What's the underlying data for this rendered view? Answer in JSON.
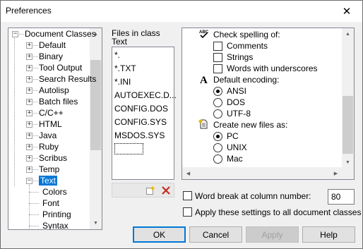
{
  "window": {
    "title": "Preferences",
    "close_glyph": "✕"
  },
  "tree": {
    "items": [
      {
        "label": "Document Classes",
        "expander": "−"
      },
      {
        "label": "Default",
        "expander": "+"
      },
      {
        "label": "Binary",
        "expander": "+"
      },
      {
        "label": "Tool Output",
        "expander": "+"
      },
      {
        "label": "Search Results",
        "expander": "+"
      },
      {
        "label": "Autolisp",
        "expander": "+"
      },
      {
        "label": "Batch files",
        "expander": "+"
      },
      {
        "label": "C/C++",
        "expander": "+"
      },
      {
        "label": "HTML",
        "expander": "+"
      },
      {
        "label": "Java",
        "expander": "+"
      },
      {
        "label": "Ruby",
        "expander": "+"
      },
      {
        "label": "Scribus",
        "expander": "+"
      },
      {
        "label": "Temp",
        "expander": "+"
      },
      {
        "label": "Text",
        "expander": "−",
        "selected": true
      },
      {
        "label": "Colors"
      },
      {
        "label": "Font"
      },
      {
        "label": "Printing"
      },
      {
        "label": "Syntax"
      }
    ]
  },
  "files": {
    "header_line1": "Files in class",
    "header_line2": "Text",
    "items": [
      "*.",
      "*.TXT",
      "*.INI",
      "AUTOEXEC.D...",
      "CONFIG.DOS",
      "CONFIG.SYS",
      "MSDOS.SYS"
    ],
    "new_icon": "new-item-icon",
    "delete_icon": "delete-icon"
  },
  "options": {
    "spell_heading": "Check spelling of:",
    "spell_items": [
      {
        "label": "Comments",
        "checked": false
      },
      {
        "label": "Strings",
        "checked": false
      },
      {
        "label": "Words with underscores",
        "checked": false
      }
    ],
    "encoding_heading": "Default encoding:",
    "encoding_items": [
      {
        "label": "ANSI",
        "selected": true
      },
      {
        "label": "DOS",
        "selected": false
      },
      {
        "label": "UTF-8",
        "selected": false
      }
    ],
    "newfiles_heading": "Create new files as:",
    "newfiles_items": [
      {
        "label": "PC",
        "selected": true
      },
      {
        "label": "UNIX",
        "selected": false
      },
      {
        "label": "Mac",
        "selected": false
      }
    ]
  },
  "wordbreak": {
    "label": "Word break at column number:",
    "value": "80",
    "checked": false
  },
  "apply_all": {
    "label": "Apply these settings to all document classes",
    "checked": false
  },
  "buttons": {
    "ok": "OK",
    "cancel": "Cancel",
    "apply": "Apply",
    "help": "Help"
  },
  "colors": {
    "selection": "#0078d7",
    "delete_red": "#c42b1c"
  }
}
